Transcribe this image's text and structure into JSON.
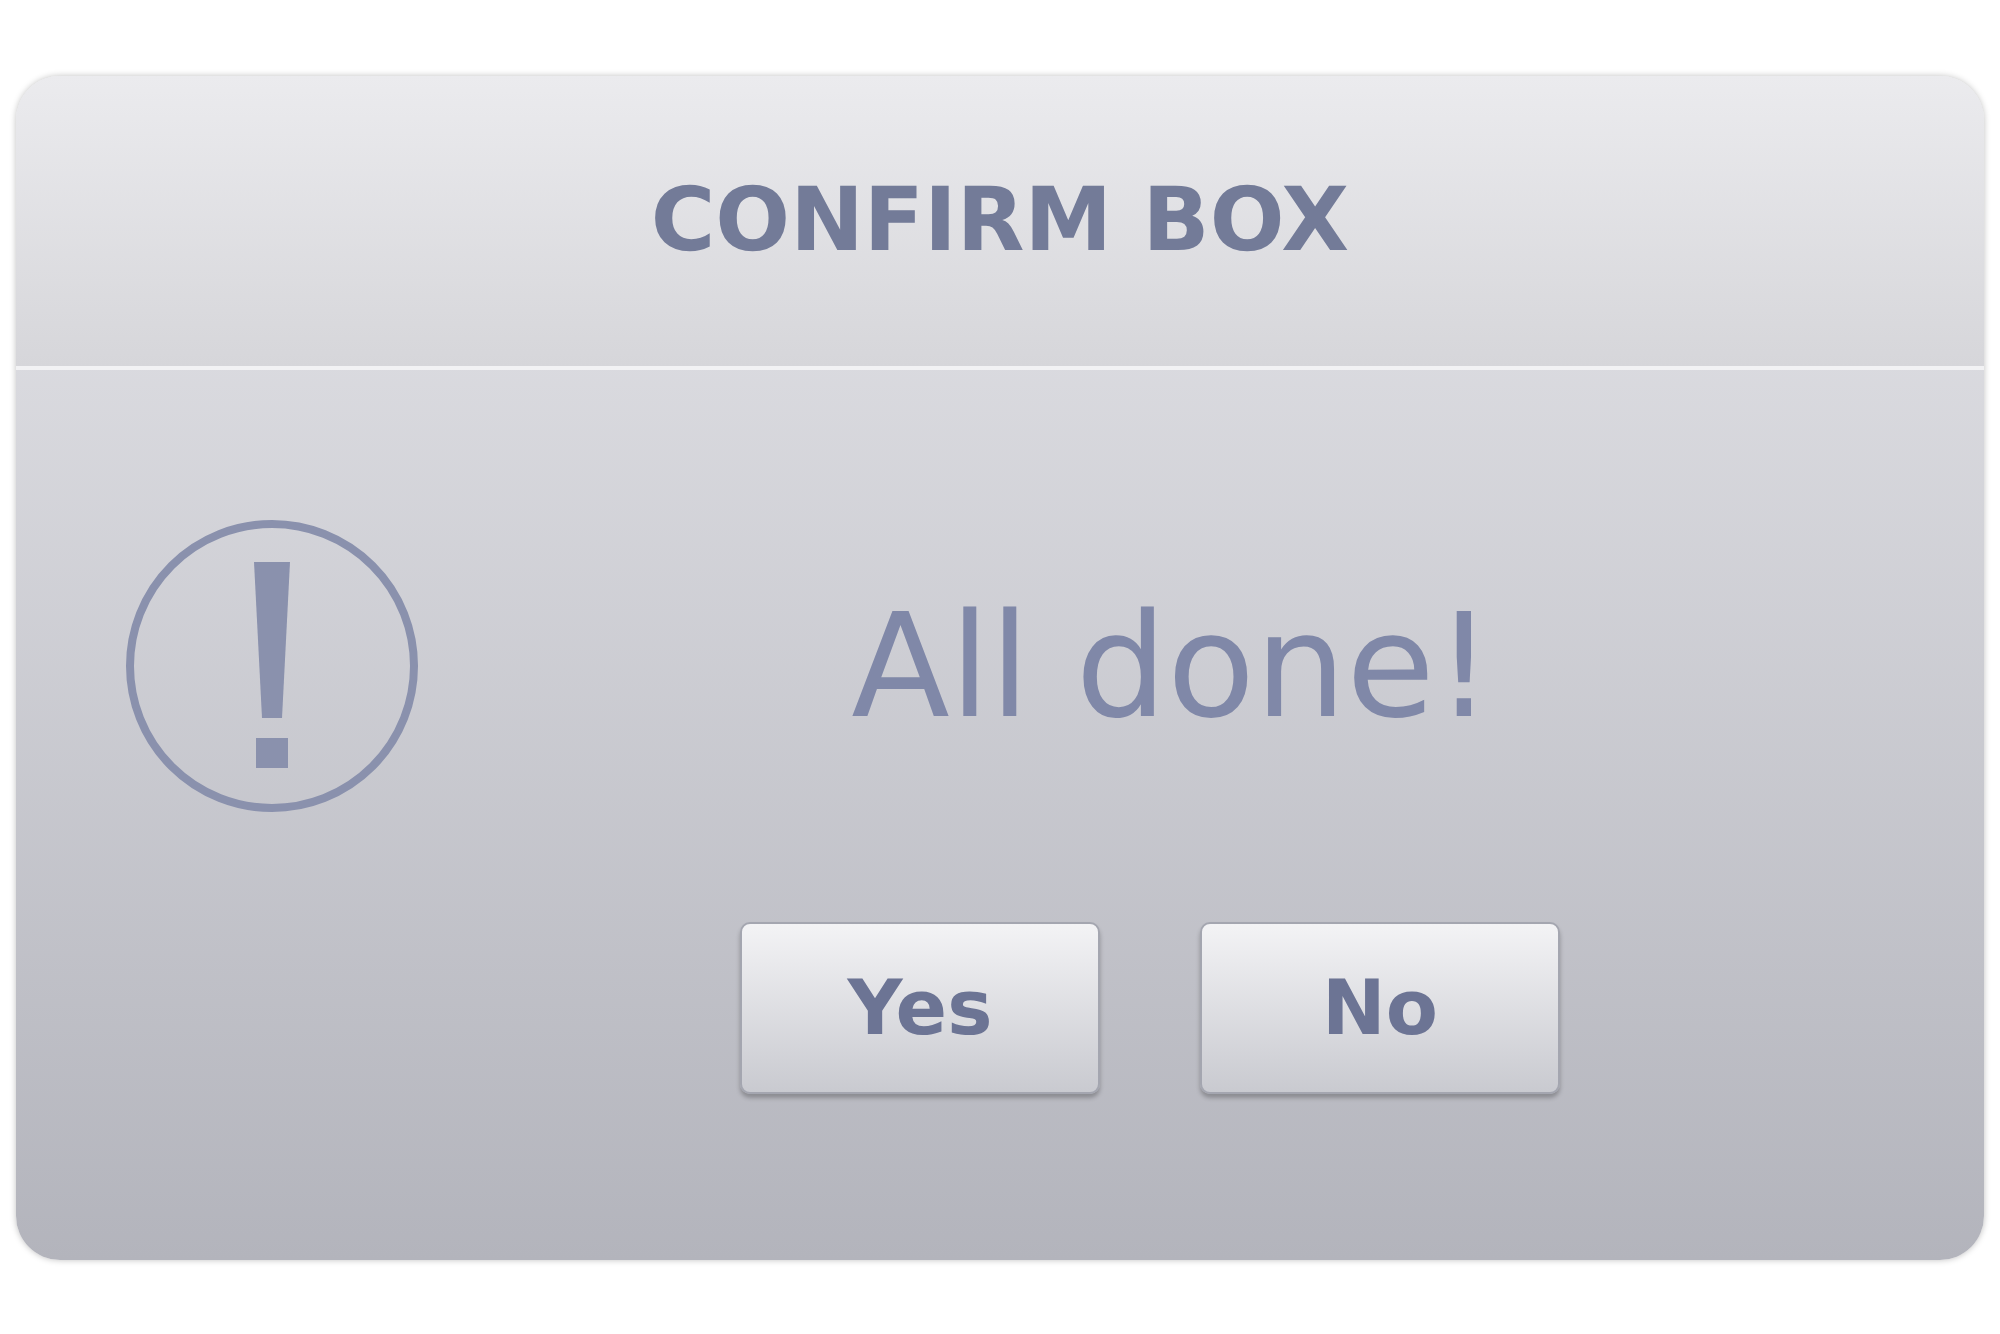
{
  "dialog": {
    "title": "CONFIRM BOX",
    "message": "All done!",
    "buttons": [
      {
        "label": "Yes"
      },
      {
        "label": "No"
      }
    ]
  }
}
